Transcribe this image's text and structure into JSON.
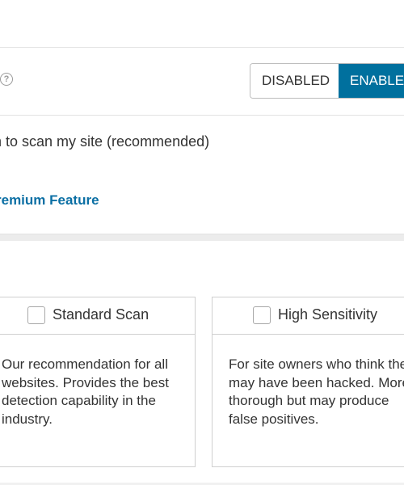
{
  "option": {
    "help_icon_glyph": "?",
    "toggle": {
      "disabled_label": "DISABLED",
      "enabled_label": "ENABLED",
      "selected": "ENABLED",
      "active_color": "#00709e"
    }
  },
  "description": {
    "text": "n to scan my site (recommended)",
    "premium_link": "remium Feature",
    "link_color": "#0b6fa4"
  },
  "scan_options": [
    {
      "title": "Standard Scan",
      "checked": false,
      "body": "Our recommendation for all websites. Provides the best detection capability in the industry."
    },
    {
      "title": "High Sensitivity",
      "checked": false,
      "body": "For site owners who think they may have been hacked. More thorough but may produce false positives."
    }
  ]
}
